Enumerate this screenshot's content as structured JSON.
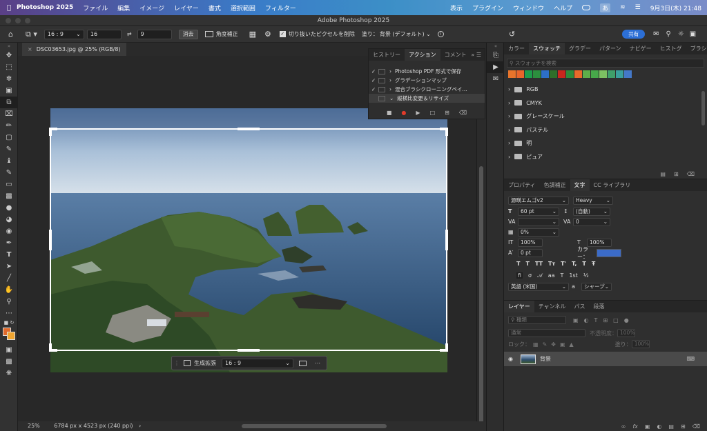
{
  "menubar": {
    "app": "Photoshop 2025",
    "items": [
      "ファイル",
      "編集",
      "イメージ",
      "レイヤー",
      "書式",
      "選択範囲",
      "フィルター"
    ],
    "right_items": [
      "表示",
      "プラグイン",
      "ウィンドウ",
      "ヘルプ"
    ],
    "input_method": "あ",
    "datetime": "9月3日(木) 21:48"
  },
  "window": {
    "title": "Adobe Photoshop 2025"
  },
  "options": {
    "ratio": "16 : 9",
    "width": "16",
    "height": "9",
    "clear": "消去",
    "straighten": "角度補正",
    "delete_cropped": "切り抜いたピクセルを削除",
    "fill_label": "塗り：",
    "fill_value": "背景 (デフォルト)",
    "share": "共有"
  },
  "document": {
    "tab": "DSC03653.jpg @ 25% (RGB/8)",
    "zoom": "25%",
    "info": "6784 px x 4523 px (240 ppi)"
  },
  "context_bar": {
    "generative_expand": "生成拡張",
    "ratio": "16 : 9"
  },
  "actions_panel": {
    "tabs": [
      "ヒストリー",
      "アクション",
      "コメント"
    ],
    "rows": [
      "Photoshop PDF 形式で保存",
      "グラデーションマップ",
      "混合ブラシクローニングペイ...",
      "縦横比変更＆リサイズ"
    ]
  },
  "swatches_panel": {
    "tabs": [
      "カラー",
      "スウォッチ",
      "グラデー",
      "パターン",
      "ナビゲー",
      "ヒストグ",
      "ブラシ設!"
    ],
    "search_placeholder": "スウォッチを検索",
    "colors": [
      "#e8742b",
      "#e8652b",
      "#1e9c4b",
      "#2c8f3e",
      "#2d6fc8",
      "#2f6e2a",
      "#c8271e",
      "#2f8a3a",
      "#e86a2b",
      "#5fae4a",
      "#47a84a",
      "#7cc062",
      "#3f9f6a",
      "#3a9f9c",
      "#4478c8"
    ],
    "folders": [
      "RGB",
      "CMYK",
      "グレースケール",
      "パステル",
      "明",
      "ピュア"
    ]
  },
  "properties_panel": {
    "tabs": [
      "プロパティ",
      "色調補正",
      "文字",
      "CC ライブラリ"
    ],
    "font_family": "源暎エムゴv2",
    "font_style": "Heavy",
    "font_size": "60 pt",
    "leading": "(自動)",
    "kerning": "",
    "tracking": "0",
    "tsume": "0%",
    "vscale": "100%",
    "hscale": "100%",
    "baseline": "0 pt",
    "color_label": "カラー：",
    "text_color": "#3b6bc8",
    "language": "英語 (米国)",
    "aa_label": "a",
    "antialias": "シャープ"
  },
  "layers_panel": {
    "tabs": [
      "レイヤー",
      "チャンネル",
      "パス",
      "段落"
    ],
    "search_placeholder": "種類",
    "blend": "通常",
    "opacity_label": "不透明度：",
    "opacity": "100%",
    "lock_label": "ロック：",
    "fill_label": "塗り：",
    "fill": "100%",
    "layer_name": "背景"
  }
}
